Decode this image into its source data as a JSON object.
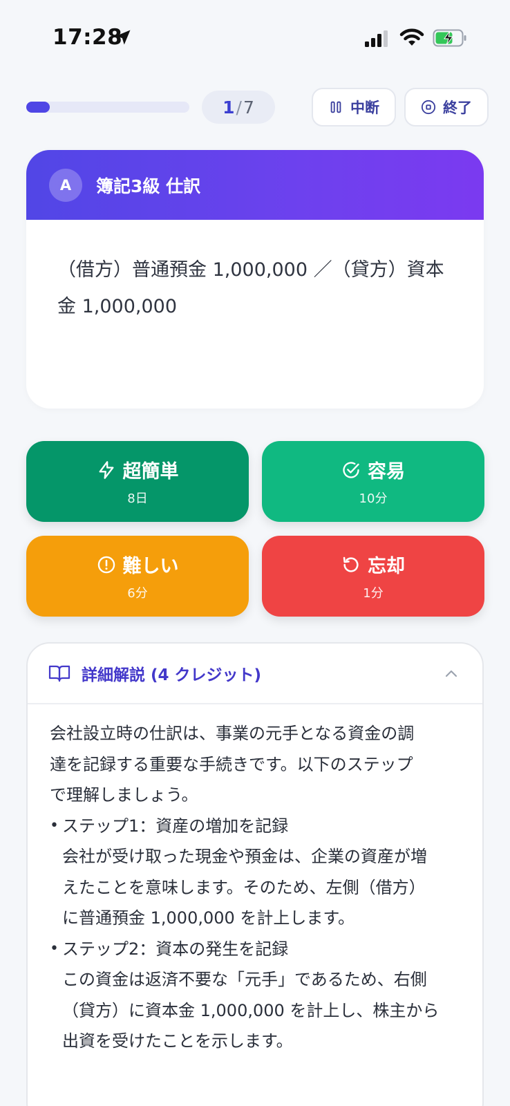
{
  "status_bar": {
    "time": "17:28"
  },
  "progress": {
    "current": "1",
    "separator": "/",
    "total": "7",
    "fraction": 0.143
  },
  "top_buttons": {
    "pause_label": "中断",
    "end_label": "終了"
  },
  "card": {
    "avatar_letter": "A",
    "title": "簿記3級 仕訳",
    "question_line1": "（借方）普通預金 1,000,000 ／（貸方）資本",
    "question_line2": "金 1,000,000"
  },
  "answers": [
    {
      "label": "超簡単",
      "interval": "8日",
      "icon": "bolt-icon",
      "color": "#059669"
    },
    {
      "label": "容易",
      "interval": "10分",
      "icon": "check-circle-icon",
      "color": "#10b981"
    },
    {
      "label": "難しい",
      "interval": "6分",
      "icon": "alert-circle-icon",
      "color": "#f59e0b"
    },
    {
      "label": "忘却",
      "interval": "1分",
      "icon": "rotate-ccw-icon",
      "color": "#ef4444"
    }
  ],
  "detail": {
    "title": "詳細解説 (4 クレジット)",
    "intro_line1": "会社設立時の仕訳は、事業の元手となる資金の調",
    "intro_line2": "達を記録する重要な手続きです。以下のステップ",
    "intro_line3": "で理解しましょう。",
    "step1_title": "ステップ1：資産の増加を記録",
    "step1_line1": "会社が受け取った現金や預金は、企業の資産が増",
    "step1_line2": "えたことを意味します。そのため、左側（借方）",
    "step1_line3": "に普通預金 1,000,000 を計上します。",
    "step2_title": "ステップ2：資本の発生を記録",
    "step2_line1": "この資金は返済不要な「元手」であるため、右側",
    "step2_line2": "（貸方）に資本金 1,000,000 を計上し、株主から",
    "step2_line3": "出資を受けたことを示します。"
  },
  "colors": {
    "accent": "#4f46e5",
    "header_gradient_end": "#7b3af0"
  }
}
